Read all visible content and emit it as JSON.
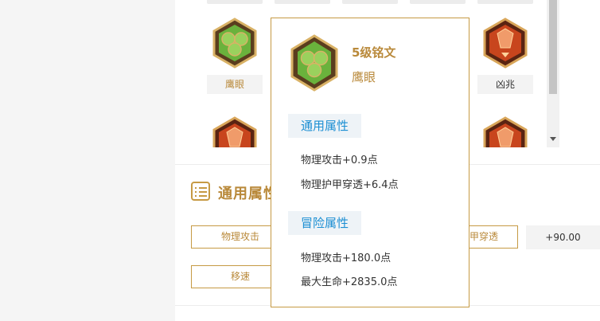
{
  "runes": [
    {
      "label": "鹰眼",
      "style": "green"
    },
    {
      "label": "凶兆",
      "style": "red"
    }
  ],
  "lower_runes": [
    {
      "style": "red"
    },
    {
      "style": "red"
    }
  ],
  "attributes_section": {
    "title": "通用属性",
    "buttons": [
      {
        "label": "物理攻击"
      },
      {
        "label": "甲穿透"
      },
      {
        "label": "移速"
      }
    ],
    "visible_value": "+90.00"
  },
  "tooltip": {
    "level": "5级铭文",
    "name": "鹰眼",
    "general_heading": "通用属性",
    "general_stats": [
      "物理攻击+0.9点",
      "物理护甲穿透+6.4点"
    ],
    "adventure_heading": "冒险属性",
    "adventure_stats": [
      "物理攻击+180.0点",
      "最大生命+2835.0点"
    ]
  },
  "colors": {
    "accent_gold": "#b9893a",
    "border_gold": "#c69a44",
    "heading_blue": "#1c8fd3",
    "rune_green": "#6ab23c",
    "rune_red": "#c8451d"
  },
  "icons": {
    "section": "list-icon",
    "scroll": "scroll-down-arrow"
  }
}
